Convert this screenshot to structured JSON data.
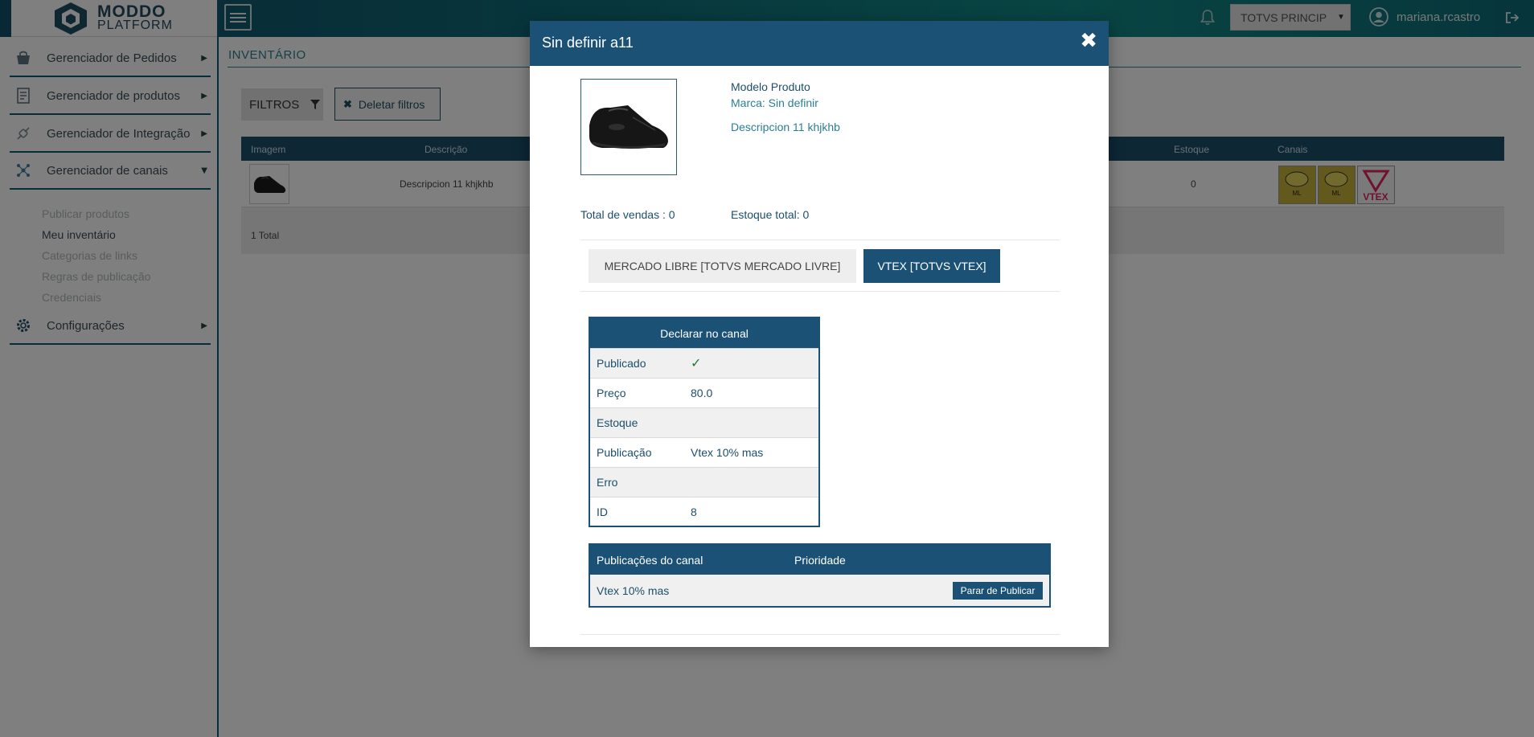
{
  "brand": {
    "line1": "MODDO",
    "line2": "PLATFORM"
  },
  "header": {
    "company": "TOTVS PRINCIP",
    "user": "mariana.rcastro"
  },
  "sidebar": {
    "items": [
      {
        "label": "Gerenciador de Pedidos",
        "icon": "orders-icon"
      },
      {
        "label": "Gerenciador de produtos",
        "icon": "products-icon"
      },
      {
        "label": "Gerenciador de Integração",
        "icon": "integration-icon"
      },
      {
        "label": "Gerenciador de canais",
        "icon": "channels-icon"
      },
      {
        "label": "Configurações",
        "icon": "settings-icon"
      }
    ],
    "subitems": [
      {
        "label": "Publicar produtos"
      },
      {
        "label": "Meu inventário"
      },
      {
        "label": "Categorias de links"
      },
      {
        "label": "Regras de publicação"
      },
      {
        "label": "Credenciais"
      }
    ]
  },
  "main": {
    "title": "INVENTÁRIO",
    "filters_label": "FILTROS",
    "delete_filters_label": "Deletar filtros",
    "table": {
      "headers": [
        "Imagem",
        "Descrição",
        "Estoque",
        "Canais"
      ],
      "rows": [
        {
          "description": "Descripcion 11 khjkhb",
          "stock": "0"
        }
      ],
      "footer": "1 Total"
    }
  },
  "modal": {
    "title": "Sin definir a11",
    "model": "Modelo Produto",
    "brand": "Marca: Sin definir",
    "description": "Descripcion 11 khjkhb",
    "total_sales": "Total de vendas : 0",
    "total_stock": "Estoque total: 0",
    "tabs": [
      {
        "label": "MERCADO LIBRE [TOTVS MERCADO LIVRE]",
        "active": false
      },
      {
        "label": "VTEX [TOTVS VTEX]",
        "active": true
      }
    ],
    "declare": {
      "title": "Declarar no canal",
      "rows": [
        {
          "key": "Publicado",
          "value": "✓"
        },
        {
          "key": "Preço",
          "value": "80.0"
        },
        {
          "key": "Estoque",
          "value": ""
        },
        {
          "key": "Publicação",
          "value": "Vtex 10% mas"
        },
        {
          "key": "Erro",
          "value": ""
        },
        {
          "key": "ID",
          "value": "8"
        }
      ]
    },
    "publications": {
      "headers": [
        "Publicações do canal",
        "Prioridade"
      ],
      "rows": [
        {
          "name": "Vtex 10% mas",
          "action": "Parar de Publicar"
        }
      ]
    }
  },
  "colors": {
    "primary": "#1a5175",
    "accent": "#2b7e92",
    "check": "#1c7a2a"
  }
}
